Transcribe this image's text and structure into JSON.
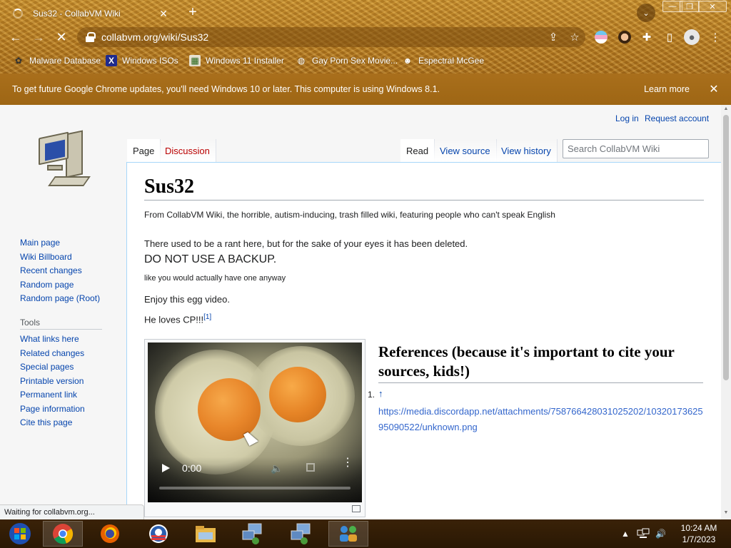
{
  "browser": {
    "tab_title": "Sus32 - CollabVM Wiki",
    "url": "collabvm.org/wiki/Sus32",
    "bookmarks": [
      {
        "label": "Malware Database",
        "icon": "malware-icon"
      },
      {
        "label": "Windows ISOs",
        "icon": "x-logo-icon"
      },
      {
        "label": "Windows 11 Installer",
        "icon": "page-icon"
      },
      {
        "label": "Gay Porn Sex Movie...",
        "icon": "bookmark-globe-icon"
      },
      {
        "label": "Espectral McGee",
        "icon": "avatar-icon"
      }
    ],
    "infobar_message": "To get future Google Chrome updates, you'll need Windows 10 or later. This computer is using Windows 8.1.",
    "infobar_action": "Learn more",
    "status_text": "Waiting for collabvm.org..."
  },
  "wiki": {
    "personal": {
      "login": "Log in",
      "request": "Request account"
    },
    "nav": {
      "main": [
        "Main page",
        "Wiki Billboard",
        "Recent changes",
        "Random page",
        "Random page (Root)"
      ],
      "tools_heading": "Tools",
      "tools": [
        "What links here",
        "Related changes",
        "Special pages",
        "Printable version",
        "Permanent link",
        "Page information",
        "Cite this page"
      ]
    },
    "tabs": {
      "page": "Page",
      "discussion": "Discussion",
      "read": "Read",
      "view_source": "View source",
      "view_history": "View history"
    },
    "search_placeholder": "Search CollabVM Wiki",
    "title": "Sus32",
    "site_sub": "From CollabVM Wiki, the horrible, autism-inducing, trash filled wiki, featuring people who can't speak English",
    "para1": "There used to be a rant here, but for the sake of your eyes it has been deleted.",
    "para2": "DO NOT USE A BACKUP.",
    "para3": "like you would actually have one anyway",
    "para4": "Enjoy this egg video.",
    "para5": "He loves CP!!!",
    "ref_marker": "[1]",
    "video_time": "0:00",
    "references_heading": "References (because it's important to cite your sources, kids!)",
    "ref_number": "1.",
    "ref_arrow": "↑",
    "ref_url": "https://media.discordapp.net/attachments/758766428031025202/1032017362595090522/unknown.png"
  },
  "taskbar": {
    "time": "10:24 AM",
    "date": "1/7/2023"
  },
  "colors": {
    "link": "#0645ad",
    "new_link": "#ba0000",
    "chrome_theme": "#b57b22"
  }
}
